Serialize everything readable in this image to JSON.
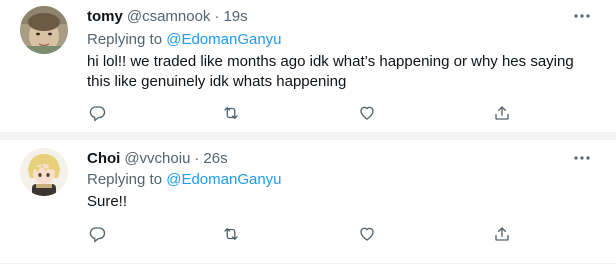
{
  "tweets": [
    {
      "display_name": "tomy",
      "handle": "@csamnook",
      "separator": "·",
      "time": "19s",
      "replying_prefix": "Replying to",
      "replying_to": "@EdomanGanyu",
      "text_lines": [
        "hi lol!! we traded like months ago idk what’s happening or why hes saying",
        "this like genuinely idk whats happening"
      ],
      "icons": {
        "more": "more-icon",
        "reply": "reply-icon",
        "retweet": "retweet-icon",
        "like": "heart-icon",
        "share": "share-icon"
      }
    },
    {
      "display_name": "Choi",
      "handle": "@vvchoiu",
      "separator": "·",
      "time": "26s",
      "replying_prefix": "Replying to",
      "replying_to": "@EdomanGanyu",
      "text_lines": [
        "Sure!!"
      ],
      "icons": {
        "more": "more-icon",
        "reply": "reply-icon",
        "retweet": "retweet-icon",
        "like": "heart-icon",
        "share": "share-icon"
      }
    }
  ],
  "colors": {
    "link": "#1d9bf0",
    "secondary_text": "#536471",
    "primary_text": "#0f1419",
    "icon": "#536471",
    "divider": "#f2f3f5"
  }
}
